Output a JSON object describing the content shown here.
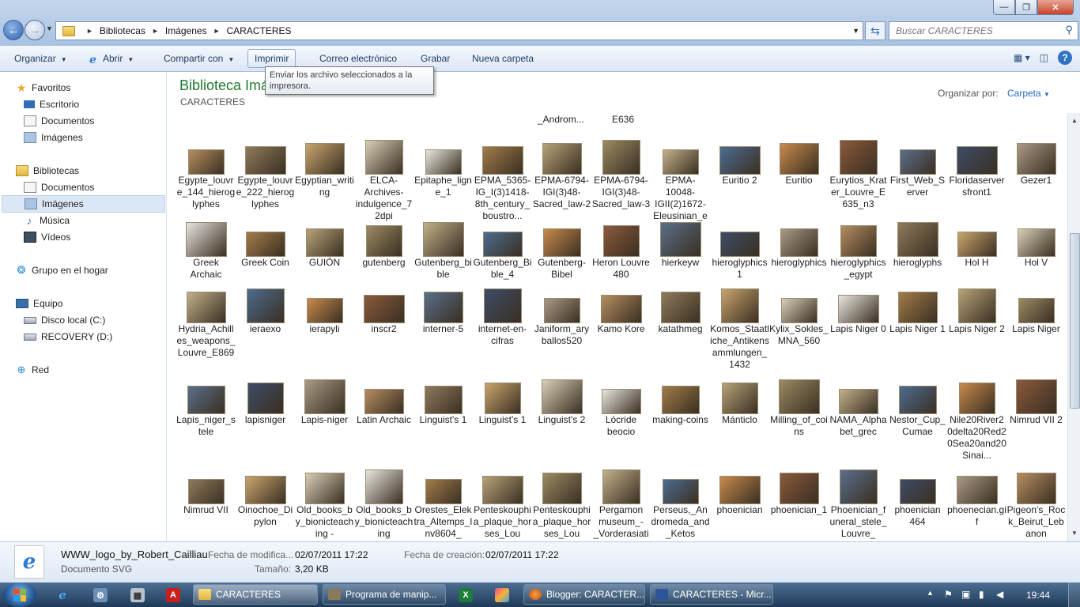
{
  "address": {
    "crumbs": [
      "Bibliotecas",
      "Imágenes",
      "CARACTERES"
    ]
  },
  "search": {
    "placeholder": "Buscar CARACTERES"
  },
  "toolbar": {
    "organize": "Organizar",
    "open": "Abrir",
    "share": "Compartir con",
    "print": "Imprimir",
    "email": "Correo electrónico",
    "burn": "Grabar",
    "new_folder": "Nueva carpeta"
  },
  "tooltip": "Enviar los archivo seleccionados a la impresora.",
  "nav": {
    "favorites": "Favoritos",
    "desktop": "Escritorio",
    "fav_documents": "Documentos",
    "fav_images": "Imágenes",
    "libraries": "Bibliotecas",
    "lib_documents": "Documentos",
    "lib_images": "Imágenes",
    "lib_music": "Música",
    "lib_videos": "Vídeos",
    "homegroup": "Grupo en el hogar",
    "computer": "Equipo",
    "disk_c": "Disco local (C:)",
    "disk_d": "RECOVERY (D:)",
    "network": "Red"
  },
  "library": {
    "title": "Biblioteca Imágenes",
    "subtitle": "CARACTERES",
    "arrange_label": "Organizar por:",
    "arrange_value": "Carpeta"
  },
  "partial_labels": [
    "_Androm...",
    "E636"
  ],
  "files": [
    [
      "Egypte_louvre_144_hieroglyphes",
      "Egypte_louvre_222_hieroglyphes",
      "Egyptian_writing",
      "ELCA-Archives-indulgence_72dpi",
      "Epitaphe_ligne_1",
      "EPMA_5365-IG_I(3)1418-8th_century_boustro...",
      "EPMA-6794-IGI(3)48-Sacred_law-2",
      "EPMA-6794-IGI(3)48-Sacred_law-3",
      "EPMA-10048-IGII(2)1672-Eleusinian_epistata...",
      "Euritio 2",
      "Euritio",
      "Eurytios_Krater_Louvre_E635_n3",
      "First_Web_Server",
      "Floridaserversfront1",
      "Gezer1"
    ],
    [
      "Greek Archaic",
      "Greek Coin",
      "GUIÓN",
      "gutenberg",
      "Gutenberg_bible",
      "Gutenberg_Bible_4",
      "Gutenberg-Bibel",
      "Heron Louvre 480",
      "hierkeyw",
      "hieroglyphics 1",
      "hieroglyphics",
      "hieroglyphics_egypt",
      "hieroglyphs",
      "Hol H",
      "Hol V"
    ],
    [
      "Hydria_Achilles_weapons_Louvre_E869",
      "ieraexo",
      "ierapyli",
      "inscr2",
      "interner-5",
      "internet-en-cifras",
      "Janiform_aryballos520",
      "Kamo Kore",
      "katathmeg",
      "Komos_Staatliche_Antikensammlungen_1432",
      "Kylix_Sokles_MNA_560",
      "Lapis Niger 0",
      "Lapis Niger 1",
      "Lapis Niger 2",
      "Lapis Niger"
    ],
    [
      "Lapis_niger_stele",
      "lapisniger",
      "Lapis-niger",
      "Latin Archaic",
      "Linguist's 1",
      "Linguist's 1",
      "Linguist's 2",
      "Lócride beocio",
      "making-coins",
      "Mánticlo",
      "Milling_of_coins",
      "NAMA_Alphabet_grec",
      "Nestor_Cup_Cumae",
      "Nile20River20delta20Red20Sea20and20Sinai...",
      "Nimrud VII 2"
    ],
    [
      "Nimrud VII",
      "Oinochoe_Dipylon",
      "Old_books_by_bionicteaching -",
      "Old_books_by_bionicteaching",
      "Orestes_Elektra_Altemps_Inv8604_",
      "Penteskouphia_plaque_horses_Lou",
      "Penteskouphia_plaque_horses_Lou",
      "Pergamon museum_-_Vorderasiati",
      "Perseus,_Andromeda_and_Ketos",
      "phoenician",
      "phoenician_1",
      "Phoenician_funeral_stele_Louvre_",
      "phoenician 464",
      "phoenecian.gif",
      "Pigeon's_Rock_Beirut_Lebanon"
    ]
  ],
  "details": {
    "name": "WWW_logo_by_Robert_Cailliau",
    "type": "Documento SVG",
    "modified_label": "Fecha de modifica...",
    "modified_value": "02/07/2011 17:22",
    "size_label": "Tamaño:",
    "size_value": "3,20 KB",
    "created_label": "Fecha de creación:",
    "created_value": "02/07/2011 17:22"
  },
  "taskbar": {
    "tasks": [
      "CARACTERES",
      "Programa de manip...",
      "Blogger: CARACTER...",
      "CARACTERES - Micr..."
    ],
    "clock": "19:44"
  }
}
